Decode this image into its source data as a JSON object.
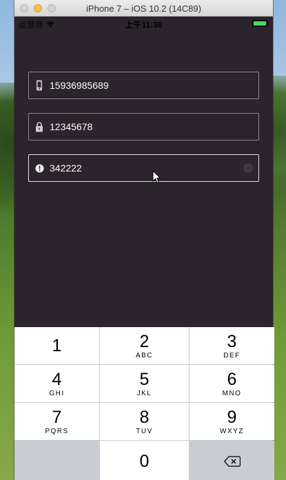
{
  "window": {
    "title": "iPhone 7 – iOS 10.2 (14C89)"
  },
  "status_bar": {
    "carrier": "运营商",
    "time": "上午11:36",
    "battery_color": "#4cd964"
  },
  "form": {
    "phone": {
      "value": "15936985689",
      "icon": "phone-icon"
    },
    "password": {
      "value": "12345678",
      "icon": "lock-icon"
    },
    "code": {
      "value": "342222",
      "icon": "alert-icon"
    }
  },
  "keypad": {
    "keys": [
      {
        "num": "1",
        "letters": ""
      },
      {
        "num": "2",
        "letters": "ABC"
      },
      {
        "num": "3",
        "letters": "DEF"
      },
      {
        "num": "4",
        "letters": "GHI"
      },
      {
        "num": "5",
        "letters": "JKL"
      },
      {
        "num": "6",
        "letters": "MNO"
      },
      {
        "num": "7",
        "letters": "PQRS"
      },
      {
        "num": "8",
        "letters": "TUV"
      },
      {
        "num": "9",
        "letters": "WXYZ"
      },
      {
        "num": "0",
        "letters": ""
      }
    ],
    "delete_icon": "backspace-icon"
  },
  "colors": {
    "app_background": "#2b242c",
    "field_border": "#8a8590",
    "keypad_background": "#c9ccd2"
  }
}
